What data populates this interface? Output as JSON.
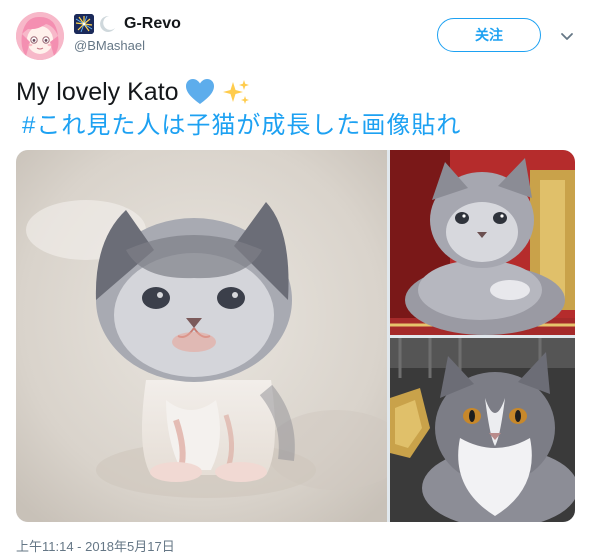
{
  "user": {
    "display_name": "G-Revo",
    "handle": "@BMashael",
    "emoji": [
      "fireworks-icon",
      "crescent-moon-icon"
    ]
  },
  "follow_button": {
    "label": "关注"
  },
  "tweet": {
    "text": "My lovely Kato",
    "emoji": [
      "blue-heart-icon",
      "sparkles-icon"
    ],
    "hashtag": "#これ見た人は子猫が成長した画像貼れ"
  },
  "media": {
    "photos": [
      {
        "name": "kitten-newborn-photo"
      },
      {
        "name": "kitten-young-photo"
      },
      {
        "name": "adult-cat-photo"
      }
    ]
  },
  "timestamp": "上午11:14 - 2018年5月17日",
  "colors": {
    "accent": "#1da1f2",
    "text_primary": "#14171a",
    "text_secondary": "#657786",
    "heart": "#5dadec",
    "sparkle": "#ffcc4d"
  }
}
